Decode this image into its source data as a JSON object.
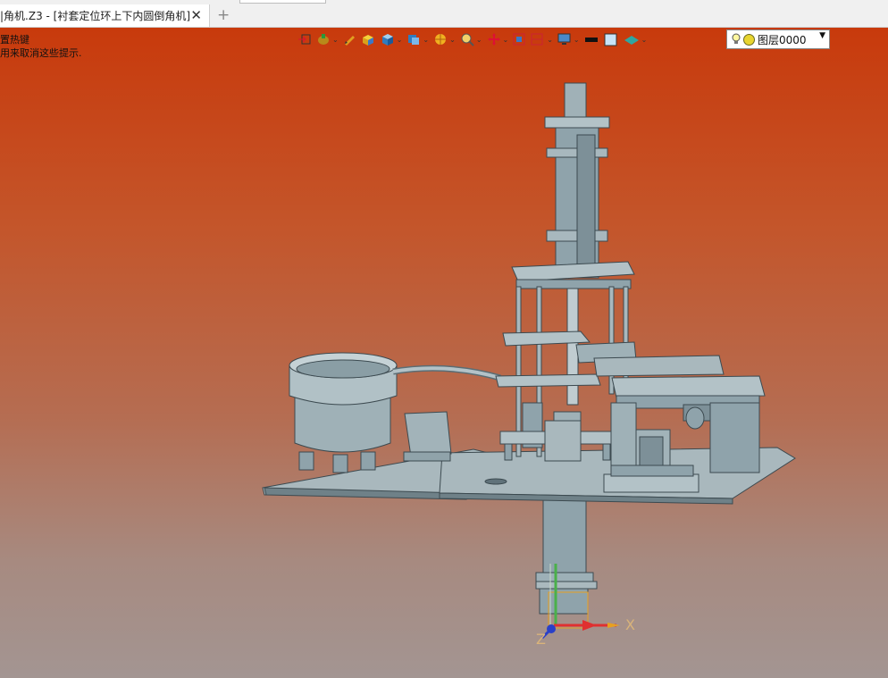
{
  "tab": {
    "title": "|角机.Z3 - [衬套定位环上下内圆倒角机]"
  },
  "hints": {
    "line1": "置热键",
    "line2": "用来取消这些提示."
  },
  "layer": {
    "name": "图层0000"
  },
  "toolbar_icons": [
    "exit-sketch-icon",
    "shade-mode-icon",
    "pen-icon",
    "box-yellow-icon",
    "cube-blue-icon",
    "view-cube-icon",
    "render-style-icon",
    "zoom-fit-icon",
    "pan-icon",
    "window-icon",
    "section-icon",
    "display-icon",
    "line-color-icon",
    "face-color-icon",
    "plane-icon"
  ],
  "axes": {
    "x": "X",
    "z": "Z"
  },
  "colors": {
    "part": "#8fa3ab",
    "part_dark": "#5e7077",
    "bg_top": "#c83a0c",
    "bg_bottom": "#a39592"
  }
}
